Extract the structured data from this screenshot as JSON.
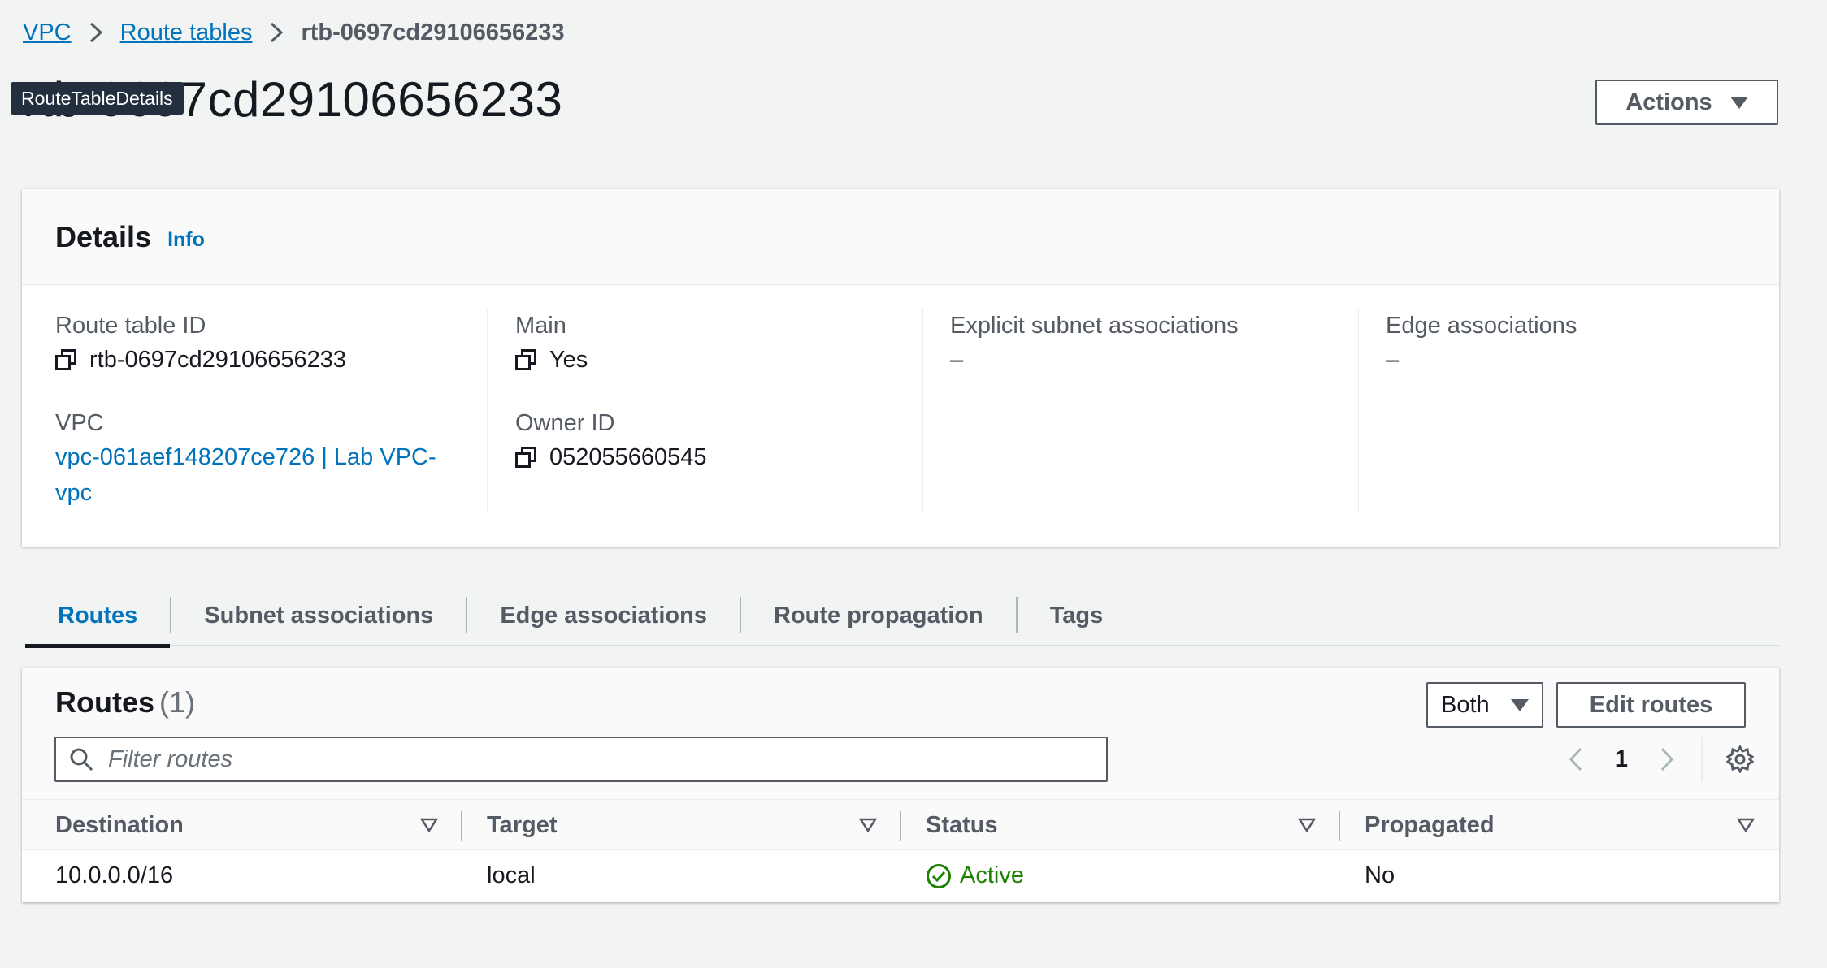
{
  "breadcrumb": {
    "items": [
      {
        "label": "VPC"
      },
      {
        "label": "Route tables"
      }
    ],
    "current": "rtb-0697cd29106656233"
  },
  "page": {
    "title": "rtb-0697cd29106656233",
    "tooltip": "RouteTableDetails",
    "actions_label": "Actions"
  },
  "details": {
    "heading": "Details",
    "info_label": "Info",
    "route_table_id_label": "Route table ID",
    "route_table_id_value": "rtb-0697cd29106656233",
    "vpc_label": "VPC",
    "vpc_value_line1": "vpc-061aef148207ce726 | Lab VPC-",
    "vpc_value_line2": "vpc",
    "main_label": "Main",
    "main_value": "Yes",
    "owner_id_label": "Owner ID",
    "owner_id_value": "052055660545",
    "explicit_subnet_label": "Explicit subnet associations",
    "explicit_subnet_value": "–",
    "edge_assoc_label": "Edge associations",
    "edge_assoc_value": "–"
  },
  "tabs": [
    {
      "label": "Routes",
      "active": true
    },
    {
      "label": "Subnet associations",
      "active": false
    },
    {
      "label": "Edge associations",
      "active": false
    },
    {
      "label": "Route propagation",
      "active": false
    },
    {
      "label": "Tags",
      "active": false
    }
  ],
  "routes": {
    "title": "Routes",
    "count": "(1)",
    "filter_select_value": "Both",
    "edit_label": "Edit routes",
    "filter_placeholder": "Filter routes",
    "current_page": "1",
    "columns": [
      "Destination",
      "Target",
      "Status",
      "Propagated"
    ],
    "rows": [
      {
        "destination": "10.0.0.0/16",
        "target": "local",
        "status": "Active",
        "propagated": "No"
      }
    ]
  },
  "colors": {
    "link": "#0073bb",
    "status_active": "#1d8102",
    "background": "#f2f3f3"
  }
}
